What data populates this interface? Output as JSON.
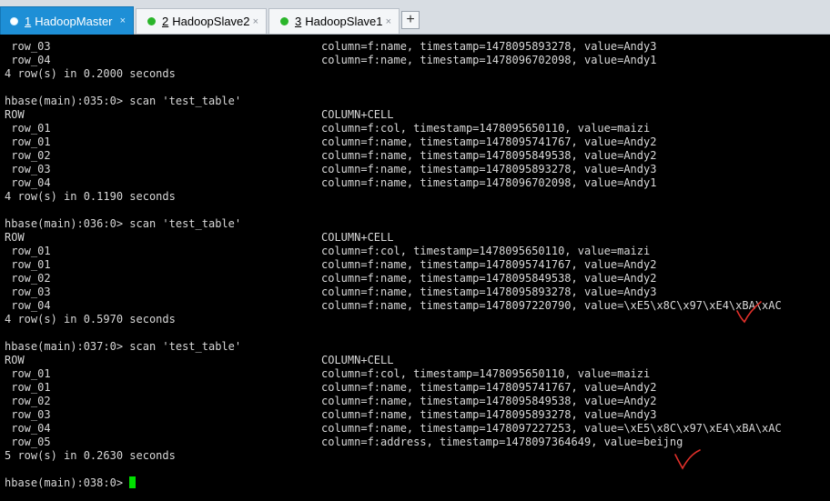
{
  "tabs": [
    {
      "number": "1",
      "label": "HadoopMaster",
      "close": "×"
    },
    {
      "number": "2",
      "label": "HadoopSlave2",
      "close": "×"
    },
    {
      "number": "3",
      "label": "HadoopSlave1",
      "close": "×"
    }
  ],
  "new_tab_label": "+",
  "colors": {
    "active_tab": "#1e8fd6",
    "status_dot": "#2ab52a",
    "cursor": "#00e000",
    "annotation": "#e0302a"
  },
  "terminal": {
    "lines": [
      {
        "left": " row_03",
        "right": "column=f:name, timestamp=1478095893278, value=Andy3"
      },
      {
        "left": " row_04",
        "right": "column=f:name, timestamp=1478096702098, value=Andy1"
      },
      {
        "left": "4 row(s) in 0.2000 seconds",
        "right": ""
      },
      {
        "left": "",
        "right": ""
      },
      {
        "left": "hbase(main):035:0> scan 'test_table'",
        "right": ""
      },
      {
        "left": "ROW",
        "right": "COLUMN+CELL"
      },
      {
        "left": " row_01",
        "right": "column=f:col, timestamp=1478095650110, value=maizi"
      },
      {
        "left": " row_01",
        "right": "column=f:name, timestamp=1478095741767, value=Andy2"
      },
      {
        "left": " row_02",
        "right": "column=f:name, timestamp=1478095849538, value=Andy2"
      },
      {
        "left": " row_03",
        "right": "column=f:name, timestamp=1478095893278, value=Andy3"
      },
      {
        "left": " row_04",
        "right": "column=f:name, timestamp=1478096702098, value=Andy1"
      },
      {
        "left": "4 row(s) in 0.1190 seconds",
        "right": ""
      },
      {
        "left": "",
        "right": ""
      },
      {
        "left": "hbase(main):036:0> scan 'test_table'",
        "right": ""
      },
      {
        "left": "ROW",
        "right": "COLUMN+CELL"
      },
      {
        "left": " row_01",
        "right": "column=f:col, timestamp=1478095650110, value=maizi"
      },
      {
        "left": " row_01",
        "right": "column=f:name, timestamp=1478095741767, value=Andy2"
      },
      {
        "left": " row_02",
        "right": "column=f:name, timestamp=1478095849538, value=Andy2"
      },
      {
        "left": " row_03",
        "right": "column=f:name, timestamp=1478095893278, value=Andy3"
      },
      {
        "left": " row_04",
        "right": "column=f:name, timestamp=1478097220790, value=\\xE5\\x8C\\x97\\xE4\\xBA\\xAC"
      },
      {
        "left": "4 row(s) in 0.5970 seconds",
        "right": ""
      },
      {
        "left": "",
        "right": ""
      },
      {
        "left": "hbase(main):037:0> scan 'test_table'",
        "right": ""
      },
      {
        "left": "ROW",
        "right": "COLUMN+CELL"
      },
      {
        "left": " row_01",
        "right": "column=f:col, timestamp=1478095650110, value=maizi"
      },
      {
        "left": " row_01",
        "right": "column=f:name, timestamp=1478095741767, value=Andy2"
      },
      {
        "left": " row_02",
        "right": "column=f:name, timestamp=1478095849538, value=Andy2"
      },
      {
        "left": " row_03",
        "right": "column=f:name, timestamp=1478095893278, value=Andy3"
      },
      {
        "left": " row_04",
        "right": "column=f:name, timestamp=1478097227253, value=\\xE5\\x8C\\x97\\xE4\\xBA\\xAC"
      },
      {
        "left": " row_05",
        "right": "column=f:address, timestamp=1478097364649, value=beijng"
      },
      {
        "left": "5 row(s) in 0.2630 seconds",
        "right": ""
      },
      {
        "left": "",
        "right": ""
      },
      {
        "left": "hbase(main):038:0> ",
        "right": ""
      }
    ]
  }
}
